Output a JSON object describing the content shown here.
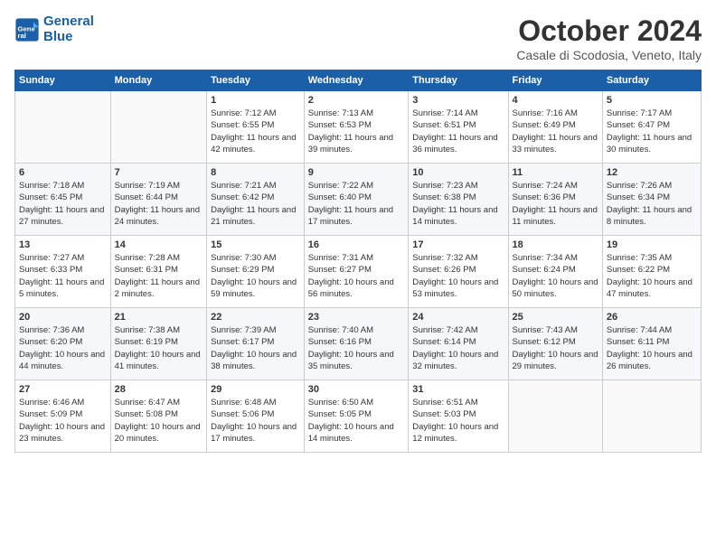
{
  "logo": {
    "line1": "General",
    "line2": "Blue"
  },
  "title": "October 2024",
  "subtitle": "Casale di Scodosia, Veneto, Italy",
  "headers": [
    "Sunday",
    "Monday",
    "Tuesday",
    "Wednesday",
    "Thursday",
    "Friday",
    "Saturday"
  ],
  "weeks": [
    [
      {
        "day": "",
        "sunrise": "",
        "sunset": "",
        "daylight": ""
      },
      {
        "day": "",
        "sunrise": "",
        "sunset": "",
        "daylight": ""
      },
      {
        "day": "1",
        "sunrise": "Sunrise: 7:12 AM",
        "sunset": "Sunset: 6:55 PM",
        "daylight": "Daylight: 11 hours and 42 minutes."
      },
      {
        "day": "2",
        "sunrise": "Sunrise: 7:13 AM",
        "sunset": "Sunset: 6:53 PM",
        "daylight": "Daylight: 11 hours and 39 minutes."
      },
      {
        "day": "3",
        "sunrise": "Sunrise: 7:14 AM",
        "sunset": "Sunset: 6:51 PM",
        "daylight": "Daylight: 11 hours and 36 minutes."
      },
      {
        "day": "4",
        "sunrise": "Sunrise: 7:16 AM",
        "sunset": "Sunset: 6:49 PM",
        "daylight": "Daylight: 11 hours and 33 minutes."
      },
      {
        "day": "5",
        "sunrise": "Sunrise: 7:17 AM",
        "sunset": "Sunset: 6:47 PM",
        "daylight": "Daylight: 11 hours and 30 minutes."
      }
    ],
    [
      {
        "day": "6",
        "sunrise": "Sunrise: 7:18 AM",
        "sunset": "Sunset: 6:45 PM",
        "daylight": "Daylight: 11 hours and 27 minutes."
      },
      {
        "day": "7",
        "sunrise": "Sunrise: 7:19 AM",
        "sunset": "Sunset: 6:44 PM",
        "daylight": "Daylight: 11 hours and 24 minutes."
      },
      {
        "day": "8",
        "sunrise": "Sunrise: 7:21 AM",
        "sunset": "Sunset: 6:42 PM",
        "daylight": "Daylight: 11 hours and 21 minutes."
      },
      {
        "day": "9",
        "sunrise": "Sunrise: 7:22 AM",
        "sunset": "Sunset: 6:40 PM",
        "daylight": "Daylight: 11 hours and 17 minutes."
      },
      {
        "day": "10",
        "sunrise": "Sunrise: 7:23 AM",
        "sunset": "Sunset: 6:38 PM",
        "daylight": "Daylight: 11 hours and 14 minutes."
      },
      {
        "day": "11",
        "sunrise": "Sunrise: 7:24 AM",
        "sunset": "Sunset: 6:36 PM",
        "daylight": "Daylight: 11 hours and 11 minutes."
      },
      {
        "day": "12",
        "sunrise": "Sunrise: 7:26 AM",
        "sunset": "Sunset: 6:34 PM",
        "daylight": "Daylight: 11 hours and 8 minutes."
      }
    ],
    [
      {
        "day": "13",
        "sunrise": "Sunrise: 7:27 AM",
        "sunset": "Sunset: 6:33 PM",
        "daylight": "Daylight: 11 hours and 5 minutes."
      },
      {
        "day": "14",
        "sunrise": "Sunrise: 7:28 AM",
        "sunset": "Sunset: 6:31 PM",
        "daylight": "Daylight: 11 hours and 2 minutes."
      },
      {
        "day": "15",
        "sunrise": "Sunrise: 7:30 AM",
        "sunset": "Sunset: 6:29 PM",
        "daylight": "Daylight: 10 hours and 59 minutes."
      },
      {
        "day": "16",
        "sunrise": "Sunrise: 7:31 AM",
        "sunset": "Sunset: 6:27 PM",
        "daylight": "Daylight: 10 hours and 56 minutes."
      },
      {
        "day": "17",
        "sunrise": "Sunrise: 7:32 AM",
        "sunset": "Sunset: 6:26 PM",
        "daylight": "Daylight: 10 hours and 53 minutes."
      },
      {
        "day": "18",
        "sunrise": "Sunrise: 7:34 AM",
        "sunset": "Sunset: 6:24 PM",
        "daylight": "Daylight: 10 hours and 50 minutes."
      },
      {
        "day": "19",
        "sunrise": "Sunrise: 7:35 AM",
        "sunset": "Sunset: 6:22 PM",
        "daylight": "Daylight: 10 hours and 47 minutes."
      }
    ],
    [
      {
        "day": "20",
        "sunrise": "Sunrise: 7:36 AM",
        "sunset": "Sunset: 6:20 PM",
        "daylight": "Daylight: 10 hours and 44 minutes."
      },
      {
        "day": "21",
        "sunrise": "Sunrise: 7:38 AM",
        "sunset": "Sunset: 6:19 PM",
        "daylight": "Daylight: 10 hours and 41 minutes."
      },
      {
        "day": "22",
        "sunrise": "Sunrise: 7:39 AM",
        "sunset": "Sunset: 6:17 PM",
        "daylight": "Daylight: 10 hours and 38 minutes."
      },
      {
        "day": "23",
        "sunrise": "Sunrise: 7:40 AM",
        "sunset": "Sunset: 6:16 PM",
        "daylight": "Daylight: 10 hours and 35 minutes."
      },
      {
        "day": "24",
        "sunrise": "Sunrise: 7:42 AM",
        "sunset": "Sunset: 6:14 PM",
        "daylight": "Daylight: 10 hours and 32 minutes."
      },
      {
        "day": "25",
        "sunrise": "Sunrise: 7:43 AM",
        "sunset": "Sunset: 6:12 PM",
        "daylight": "Daylight: 10 hours and 29 minutes."
      },
      {
        "day": "26",
        "sunrise": "Sunrise: 7:44 AM",
        "sunset": "Sunset: 6:11 PM",
        "daylight": "Daylight: 10 hours and 26 minutes."
      }
    ],
    [
      {
        "day": "27",
        "sunrise": "Sunrise: 6:46 AM",
        "sunset": "Sunset: 5:09 PM",
        "daylight": "Daylight: 10 hours and 23 minutes."
      },
      {
        "day": "28",
        "sunrise": "Sunrise: 6:47 AM",
        "sunset": "Sunset: 5:08 PM",
        "daylight": "Daylight: 10 hours and 20 minutes."
      },
      {
        "day": "29",
        "sunrise": "Sunrise: 6:48 AM",
        "sunset": "Sunset: 5:06 PM",
        "daylight": "Daylight: 10 hours and 17 minutes."
      },
      {
        "day": "30",
        "sunrise": "Sunrise: 6:50 AM",
        "sunset": "Sunset: 5:05 PM",
        "daylight": "Daylight: 10 hours and 14 minutes."
      },
      {
        "day": "31",
        "sunrise": "Sunrise: 6:51 AM",
        "sunset": "Sunset: 5:03 PM",
        "daylight": "Daylight: 10 hours and 12 minutes."
      },
      {
        "day": "",
        "sunrise": "",
        "sunset": "",
        "daylight": ""
      },
      {
        "day": "",
        "sunrise": "",
        "sunset": "",
        "daylight": ""
      }
    ]
  ]
}
